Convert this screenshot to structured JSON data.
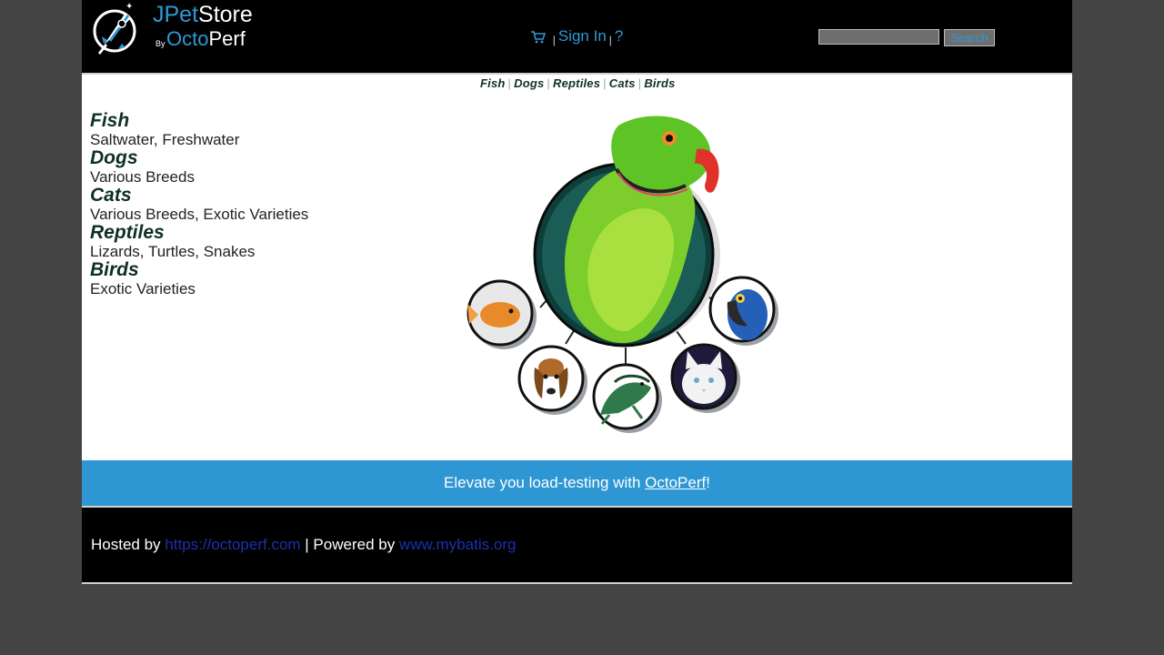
{
  "header": {
    "logo": {
      "brand_a": "JPet",
      "brand_b": "Store",
      "by": "By",
      "brand_c": "Octo",
      "brand_d": "Perf"
    },
    "menu": {
      "sign_in": "Sign In",
      "help": "?",
      "separator": "|"
    },
    "search": {
      "placeholder": "",
      "value": "",
      "button_label": "Search"
    }
  },
  "quicklinks": [
    "Fish",
    "Dogs",
    "Reptiles",
    "Cats",
    "Birds"
  ],
  "sidebar": {
    "categories": [
      {
        "name": "Fish",
        "description": "Saltwater, Freshwater"
      },
      {
        "name": "Dogs",
        "description": "Various Breeds"
      },
      {
        "name": "Cats",
        "description": "Various Breeds, Exotic Varieties"
      },
      {
        "name": "Reptiles",
        "description": "Lizards, Turtles, Snakes"
      },
      {
        "name": "Birds",
        "description": "Exotic Varieties"
      }
    ]
  },
  "banner": {
    "prefix": "Elevate you load-testing with ",
    "link": "OctoPerf",
    "suffix": "!"
  },
  "footer": {
    "hosted_prefix": "Hosted by ",
    "hosted_link": "https://octoperf.com",
    "separator": " | Powered by ",
    "powered_link": "www.mybatis.org"
  },
  "colors": {
    "accent": "#2e9ad6",
    "banner": "#2e96d2",
    "header_bg": "#000000",
    "page_bg": "#444444",
    "footer_link": "#1e2fae",
    "category_title": "#0f2f28"
  },
  "icons": [
    "rocket-logo-icon",
    "cart-icon"
  ]
}
